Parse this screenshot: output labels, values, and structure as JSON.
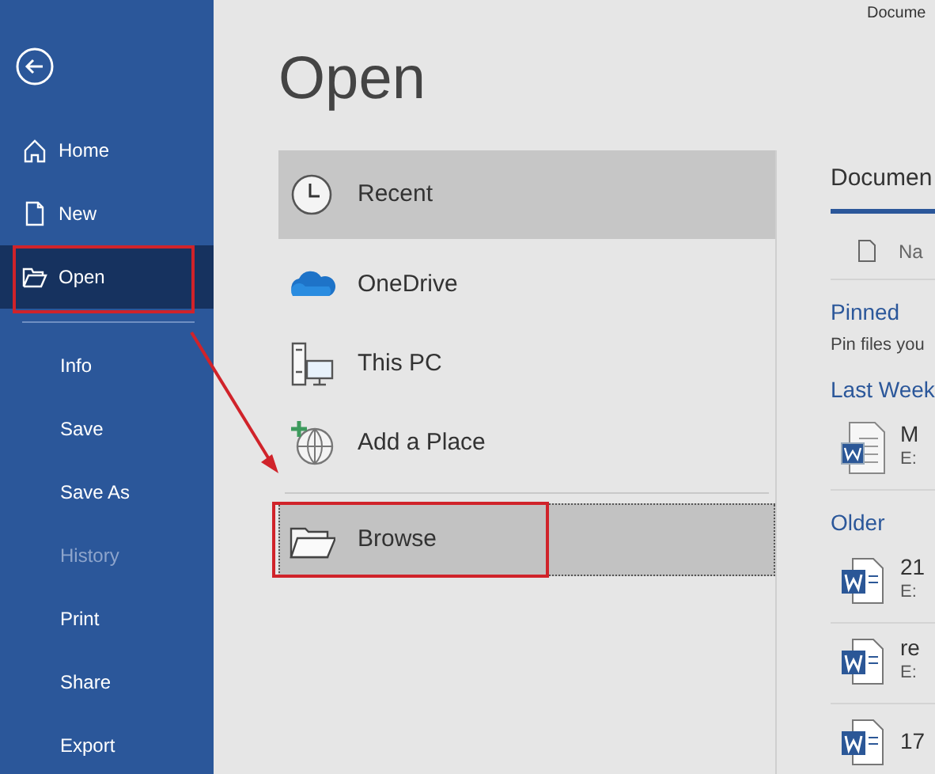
{
  "window": {
    "title": "Docume"
  },
  "sidebar": {
    "items": [
      {
        "label": "Home",
        "kind": "with_icon",
        "selected": false,
        "disabled": false,
        "highlighted": false
      },
      {
        "label": "New",
        "kind": "with_icon",
        "selected": false,
        "disabled": false,
        "highlighted": false
      },
      {
        "label": "Open",
        "kind": "with_icon",
        "selected": true,
        "disabled": false,
        "highlighted": true
      },
      {
        "label": "Info",
        "kind": "text",
        "selected": false,
        "disabled": false,
        "highlighted": false
      },
      {
        "label": "Save",
        "kind": "text",
        "selected": false,
        "disabled": false,
        "highlighted": false
      },
      {
        "label": "Save As",
        "kind": "text",
        "selected": false,
        "disabled": false,
        "highlighted": false
      },
      {
        "label": "History",
        "kind": "text",
        "selected": false,
        "disabled": true,
        "highlighted": false
      },
      {
        "label": "Print",
        "kind": "text",
        "selected": false,
        "disabled": false,
        "highlighted": false
      },
      {
        "label": "Share",
        "kind": "text",
        "selected": false,
        "disabled": false,
        "highlighted": false
      },
      {
        "label": "Export",
        "kind": "text",
        "selected": false,
        "disabled": false,
        "highlighted": false
      }
    ]
  },
  "page_title": "Open",
  "places": [
    {
      "label": "Recent",
      "kind": "recent",
      "selected": true,
      "focused": false,
      "highlighted": false
    },
    {
      "label": "OneDrive",
      "kind": "cloud",
      "selected": false,
      "focused": false,
      "highlighted": false
    },
    {
      "label": "This PC",
      "kind": "pc",
      "selected": false,
      "focused": false,
      "highlighted": false
    },
    {
      "label": "Add a Place",
      "kind": "add",
      "selected": false,
      "focused": false,
      "highlighted": false
    },
    {
      "label": "Browse",
      "kind": "browse",
      "selected": false,
      "focused": true,
      "highlighted": true
    }
  ],
  "documents": {
    "tab": "Documen",
    "column_header": "Na",
    "sections": [
      {
        "heading": "Pinned",
        "note": "Pin files you"
      },
      {
        "heading": "Last Week",
        "files": [
          {
            "name": "M",
            "path": "E:",
            "kind": "legacy"
          }
        ]
      },
      {
        "heading": "Older",
        "files": [
          {
            "name": "21",
            "path": "E:",
            "kind": "modern"
          },
          {
            "name": "re",
            "path": "E:",
            "kind": "modern"
          },
          {
            "name": "17",
            "kind": "modern"
          }
        ]
      }
    ]
  }
}
